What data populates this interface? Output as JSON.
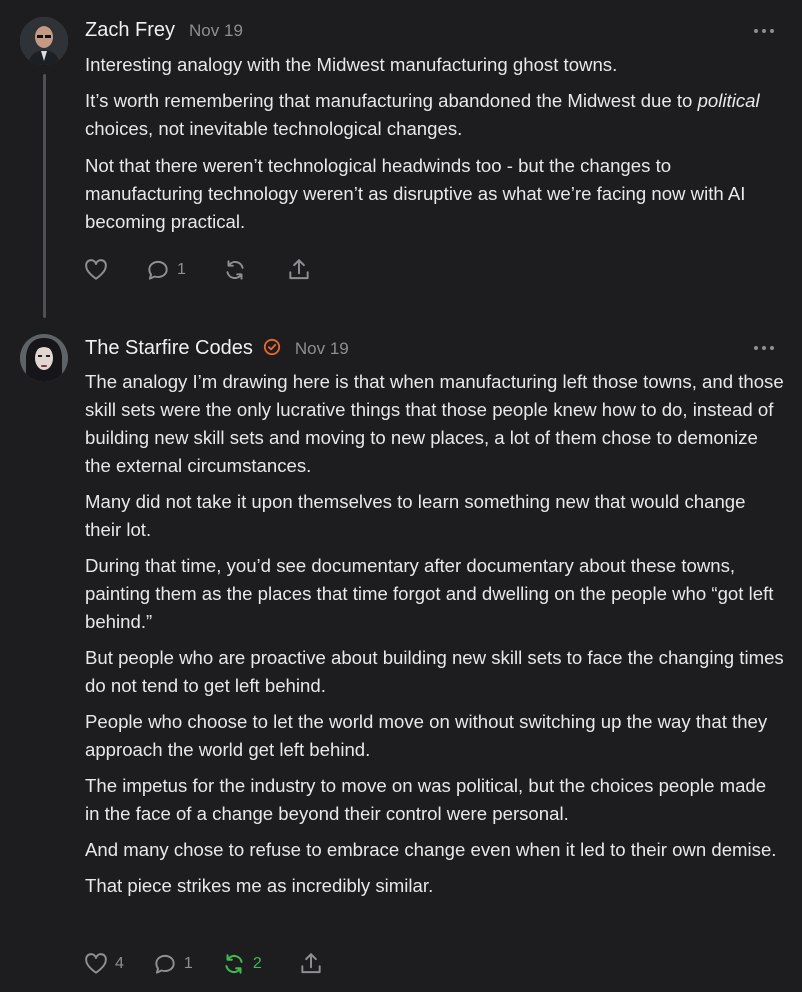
{
  "comments": [
    {
      "author": "Zach Frey",
      "date": "Nov 19",
      "paragraphs": [
        [
          "Interesting analogy with the Midwest manufacturing ghost towns."
        ],
        [
          "It’s worth remembering that manufacturing abandoned the Midwest due to "
        ],
        [
          "Not that there weren’t technological headwinds too - but the changes to manufacturing technology weren’t as disruptive as what we’re facing now with AI becoming practical."
        ]
      ],
      "emphasis": "political",
      "after_emphasis": " choices, not inevitable technological changes.",
      "actions": {
        "likes": "",
        "replies": "1",
        "restacks": ""
      }
    },
    {
      "author": "The Starfire Codes",
      "date": "Nov 19",
      "paragraphs": [
        "The analogy I’m drawing here is that when manufacturing left those towns, and those skill sets were the only lucrative things that those people knew how to do, instead of building new skill sets and moving to new places, a lot of them chose to demonize the external circumstances.",
        "Many did not take it upon themselves to learn something new that would change their lot.",
        "During that time, you’d see documentary after documentary about these towns, painting them as the places that time forgot and dwelling on the people who “got left behind.”",
        "But people who are proactive about building new skill sets to face the changing times do not tend to get left behind.",
        "People who choose to let the world move on without switching up the way that they approach the world get left behind.",
        "The impetus for the industry to move on was political, but the choices people made in the face of a change beyond their control were personal.",
        "And many chose to refuse to embrace change even when it led to their own demise.",
        "That piece strikes me as incredibly similar."
      ],
      "actions": {
        "likes": "4",
        "replies": "1",
        "restacks": "2"
      }
    }
  ],
  "colors": {
    "background": "#1d1d1f",
    "muted": "#8e8e93",
    "verified": "#e8692b",
    "restack_active": "#3fb950"
  }
}
